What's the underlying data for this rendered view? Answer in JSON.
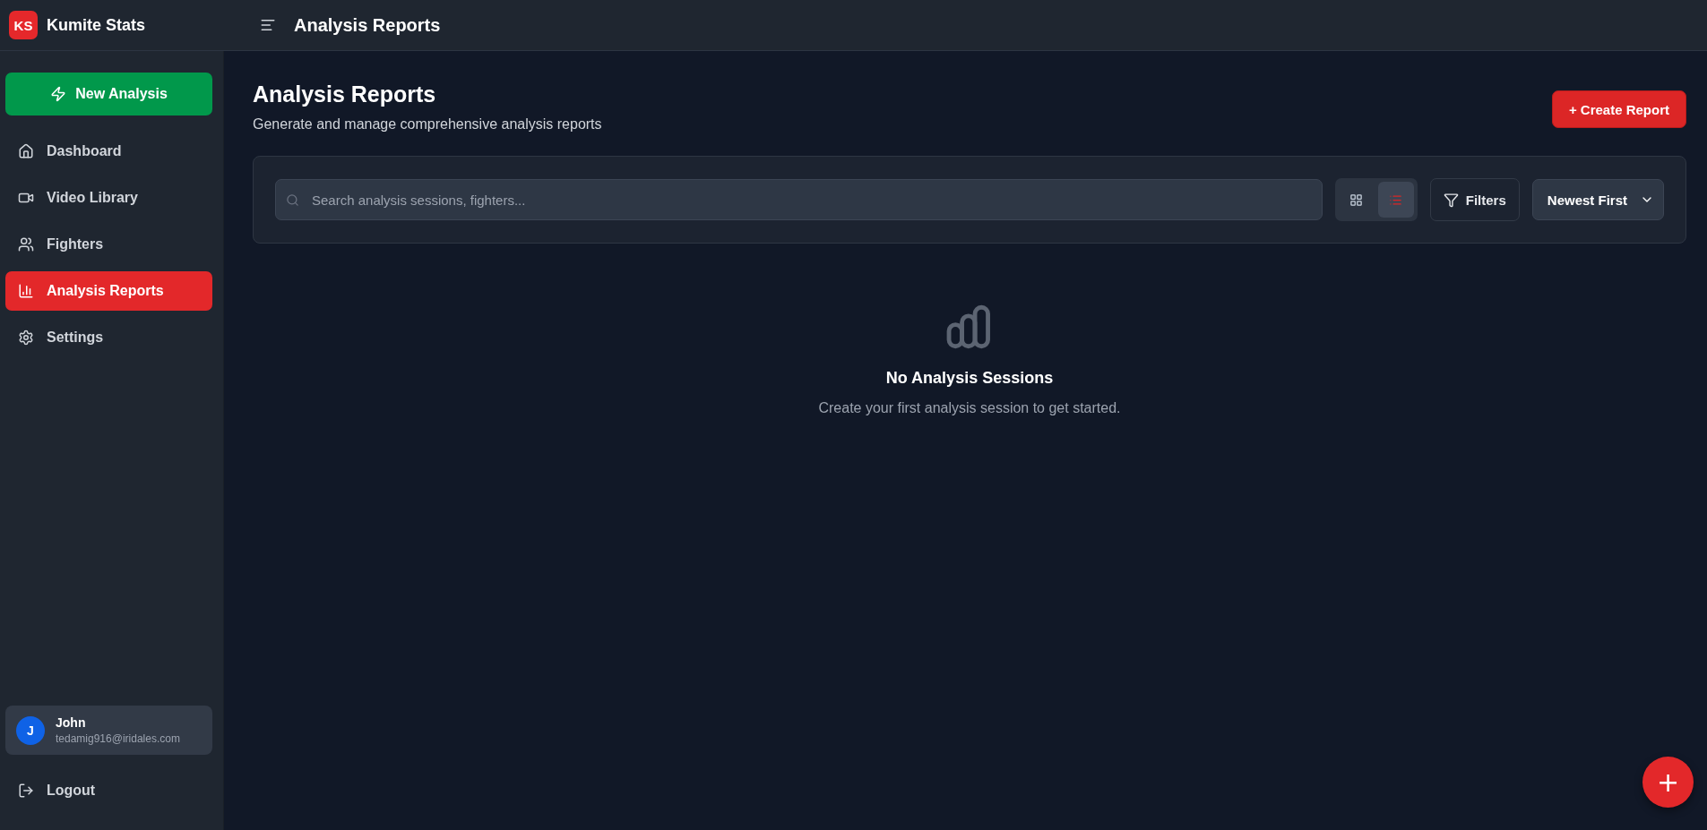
{
  "brand": {
    "logo": "KS",
    "name": "Kumite Stats"
  },
  "header": {
    "title": "Analysis Reports"
  },
  "sidebar": {
    "primary_action": "New Analysis",
    "items": [
      {
        "label": "Dashboard",
        "selected": false
      },
      {
        "label": "Video Library",
        "selected": false
      },
      {
        "label": "Fighters",
        "selected": false
      },
      {
        "label": "Analysis Reports",
        "selected": true
      },
      {
        "label": "Settings",
        "selected": false
      }
    ],
    "user": {
      "initial": "J",
      "name": "John",
      "email": "tedamig916@iridales.com"
    },
    "logout": "Logout"
  },
  "page": {
    "title": "Analysis Reports",
    "subtitle": "Generate and manage comprehensive analysis reports",
    "create_button": "+ Create Report"
  },
  "toolbar": {
    "search": {
      "placeholder": "Search analysis sessions, fighters..."
    },
    "views": [
      {
        "kind": "grid",
        "selected": false
      },
      {
        "kind": "list",
        "selected": true
      }
    ],
    "filters": "Filters",
    "sort": "Newest First"
  },
  "empty_state": {
    "title": "No Analysis Sessions",
    "message": "Create your first analysis session to get started."
  },
  "fab": "+"
}
